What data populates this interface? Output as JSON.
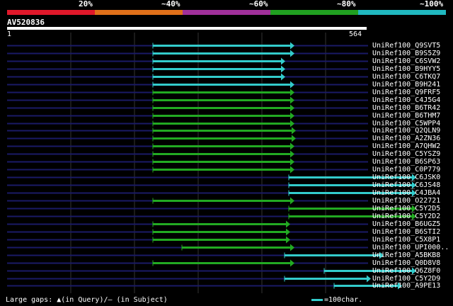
{
  "scale": {
    "segments": [
      {
        "label": "20%",
        "color": "#e0182a"
      },
      {
        "label": "~40%",
        "color": "#e0701a"
      },
      {
        "label": "~60%",
        "color": "#a0309a"
      },
      {
        "label": "~80%",
        "color": "#20a020"
      },
      {
        "label": "~100%",
        "color": "#20b8c0"
      }
    ]
  },
  "query": {
    "accession": "AV520836",
    "start": "1",
    "end": "564",
    "length": 564
  },
  "colors": {
    "cyan": "#33cccc",
    "green": "#22aa22",
    "backbone": "#1a1a66",
    "grid": "#333333"
  },
  "hits": [
    {
      "name": "UniRef100_Q9SVT5",
      "start": 216,
      "end": 416,
      "color": "cyan"
    },
    {
      "name": "UniRef100_B9S5Z9",
      "start": 216,
      "end": 416,
      "color": "cyan"
    },
    {
      "name": "UniRef100_C6SVW2",
      "start": 216,
      "end": 403,
      "color": "cyan"
    },
    {
      "name": "UniRef100_B9HYY5",
      "start": 216,
      "end": 403,
      "color": "cyan"
    },
    {
      "name": "UniRef100_C6TKQ7",
      "start": 216,
      "end": 403,
      "color": "cyan"
    },
    {
      "name": "UniRef100_B9H241",
      "start": 216,
      "end": 416,
      "color": "cyan"
    },
    {
      "name": "UniRef100_Q9FRF5",
      "start": 216,
      "end": 416,
      "color": "green"
    },
    {
      "name": "UniRef100_C4J5G4",
      "start": 216,
      "end": 416,
      "color": "green"
    },
    {
      "name": "UniRef100_B6TR42",
      "start": 216,
      "end": 416,
      "color": "green"
    },
    {
      "name": "UniRef100_B6THM7",
      "start": 216,
      "end": 416,
      "color": "green"
    },
    {
      "name": "UniRef100_C5WPP4",
      "start": 216,
      "end": 416,
      "color": "green"
    },
    {
      "name": "UniRef100_Q2QLN9",
      "start": 216,
      "end": 418,
      "color": "green"
    },
    {
      "name": "UniRef100_A2ZN36",
      "start": 216,
      "end": 418,
      "color": "green"
    },
    {
      "name": "UniRef100_A7QHW2",
      "start": 216,
      "end": 416,
      "color": "green"
    },
    {
      "name": "UniRef100_C5YSZ9",
      "start": 216,
      "end": 416,
      "color": "green"
    },
    {
      "name": "UniRef100_B6SP63",
      "start": 216,
      "end": 416,
      "color": "green"
    },
    {
      "name": "UniRef100_C0P779",
      "start": 216,
      "end": 416,
      "color": "green"
    },
    {
      "name": "UniRef100_C6JSK0",
      "start": 408,
      "end": 588,
      "color": "cyan"
    },
    {
      "name": "UniRef100_C6JS48",
      "start": 408,
      "end": 588,
      "color": "cyan"
    },
    {
      "name": "UniRef100_C4JBA4",
      "start": 408,
      "end": 588,
      "color": "cyan"
    },
    {
      "name": "UniRef100_O22721",
      "start": 216,
      "end": 416,
      "color": "green"
    },
    {
      "name": "UniRef100_C5Y2D5",
      "start": 408,
      "end": 588,
      "color": "green"
    },
    {
      "name": "UniRef100_C5Y2D2",
      "start": 408,
      "end": 588,
      "color": "green"
    },
    {
      "name": "UniRef100_B6UGZ5",
      "start": 216,
      "end": 410,
      "color": "green"
    },
    {
      "name": "UniRef100_B6STI2",
      "start": 216,
      "end": 410,
      "color": "green"
    },
    {
      "name": "UniRef100_C5X8P1",
      "start": 216,
      "end": 410,
      "color": "green"
    },
    {
      "name": "UniRef100_UPI000..",
      "start": 257,
      "end": 416,
      "color": "green"
    },
    {
      "name": "UniRef100_A5BKB8",
      "start": 402,
      "end": 542,
      "color": "cyan"
    },
    {
      "name": "UniRef100_Q0D8V8",
      "start": 216,
      "end": 416,
      "color": "green"
    },
    {
      "name": "UniRef100_Q6Z8F0",
      "start": 458,
      "end": 588,
      "color": "cyan"
    },
    {
      "name": "UniRef100_C5Y2D9",
      "start": 402,
      "end": 524,
      "color": "cyan"
    },
    {
      "name": "UniRef100_A9PE13",
      "start": 472,
      "end": 568,
      "color": "cyan"
    }
  ],
  "footer": {
    "text": "Large gaps: ▲(in Query)/– (in Subject)"
  },
  "legend": {
    "text": "=100char."
  }
}
